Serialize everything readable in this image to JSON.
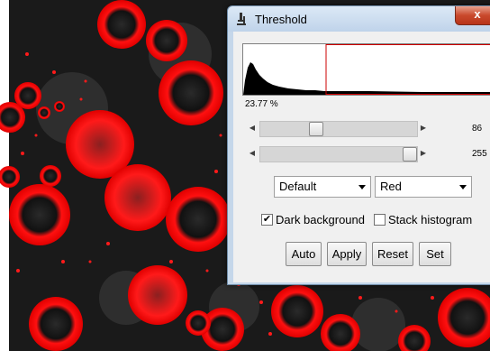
{
  "window": {
    "title": "Threshold",
    "close_label": "x"
  },
  "histogram": {
    "percent": "23.77 %"
  },
  "sliders": [
    {
      "value": "86",
      "fraction": 0.34
    },
    {
      "value": "255",
      "fraction": 1.0
    }
  ],
  "method_select": {
    "selected": "Default"
  },
  "display_select": {
    "selected": "Red"
  },
  "options": {
    "dark_background": {
      "label": "Dark background",
      "checked_mark": "✔"
    },
    "stack_histogram": {
      "label": "Stack histogram",
      "checked_mark": ""
    }
  },
  "buttons": {
    "auto": "Auto",
    "apply": "Apply",
    "reset": "Reset",
    "set": "Set"
  },
  "colors": {
    "overlay_red": "#ff0000",
    "threshold_line": "#cc0000"
  }
}
